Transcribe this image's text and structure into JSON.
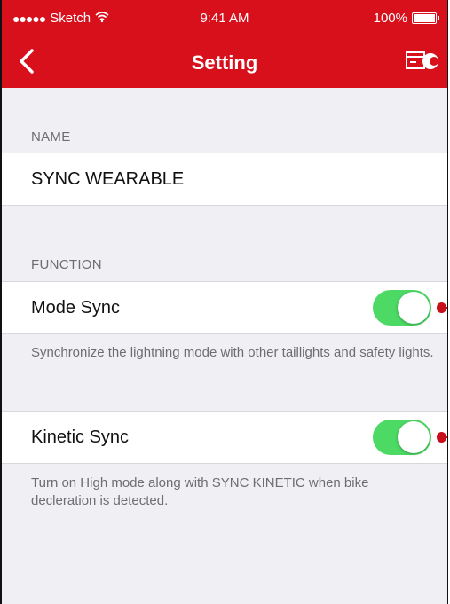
{
  "status_bar": {
    "carrier_dots": "●●●●●",
    "carrier": "Sketch",
    "time": "9:41 AM",
    "battery": "100%"
  },
  "nav": {
    "title": "Setting",
    "back_icon": "chevron-left-icon",
    "action_icon": "device-icon"
  },
  "sections": {
    "name": {
      "label": "NAME",
      "value": "SYNC WEARABLE"
    },
    "function": {
      "label": "FUNCTION",
      "items": [
        {
          "label": "Mode Sync",
          "enabled": true,
          "description": "Synchronize the lightning mode with other taillights and safety lights."
        },
        {
          "label": "Kinetic Sync",
          "enabled": true,
          "description": "Turn on High mode along with SYNC KINETIC when bike decleration is detected."
        }
      ]
    }
  },
  "colors": {
    "brand": "#d7101c",
    "toggle_on": "#4cd964",
    "background": "#efeff4"
  }
}
